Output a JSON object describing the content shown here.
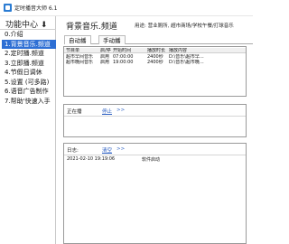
{
  "window": {
    "title": "定时播音大师 6.1"
  },
  "sidebar": {
    "header": "功能中心",
    "header_arrow": "⬇",
    "items": [
      {
        "label": "0.介绍"
      },
      {
        "label": "1.背景音乐.频道"
      },
      {
        "label": "2.定时播.频道"
      },
      {
        "label": "3.立即播.频道"
      },
      {
        "label": "4.节假日调休"
      },
      {
        "label": "5.设置 (可多路)"
      },
      {
        "label": "6.语音广告制作"
      },
      {
        "label": "7.帮助'快速入手"
      }
    ]
  },
  "main": {
    "channel_title": "背景音乐.频道",
    "usage": "用途: 营业厕所, 超市商场/学校午餐/打球音乐",
    "tabs": [
      {
        "label": "自动播"
      },
      {
        "label": "手动播"
      }
    ],
    "playlist": {
      "headers": [
        "节目单",
        "启/停",
        "开始时间",
        "播放时长",
        "播放内容"
      ],
      "rows": [
        [
          "超市早间音乐",
          "启用",
          "07:00:00",
          "2400秒",
          "D:\\音乐\\超市早..."
        ],
        [
          "超市晚间音乐",
          "启用",
          "19:00:00",
          "2400秒",
          "D:\\音乐\\超市晚..."
        ]
      ]
    },
    "playing": {
      "label": "正在播",
      "stop_link": "停止",
      "stop_suffix": " >>"
    },
    "log": {
      "label": "日志:",
      "clear_link": "清空",
      "clear_suffix": " >>",
      "entries": [
        {
          "time": "2021-02-10 19:19:06",
          "message": "软件启动"
        }
      ]
    }
  },
  "colors": {
    "accent": "#2e6fd4",
    "link": "#2b5fc2"
  }
}
